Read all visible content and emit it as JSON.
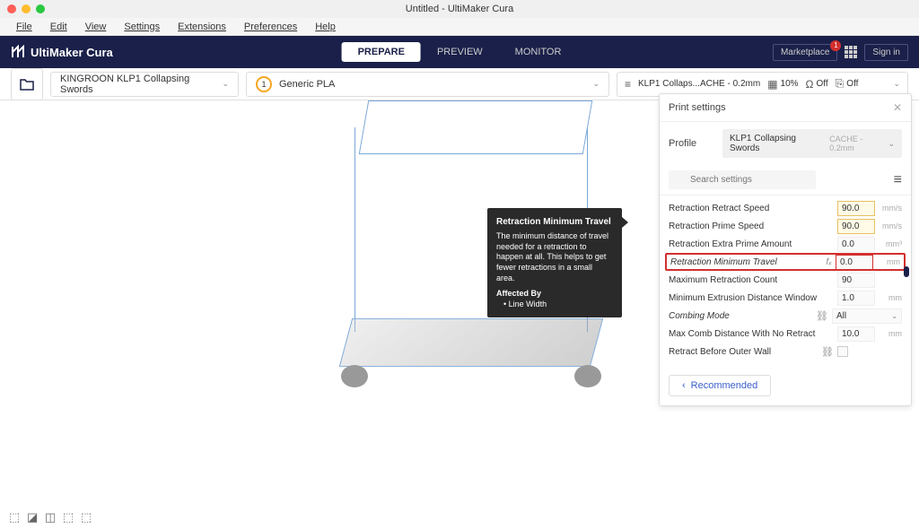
{
  "window": {
    "title": "Untitled - UltiMaker Cura"
  },
  "menubar": [
    "File",
    "Edit",
    "View",
    "Settings",
    "Extensions",
    "Preferences",
    "Help"
  ],
  "logo": "UltiMaker Cura",
  "top_tabs": {
    "prepare": "PREPARE",
    "preview": "PREVIEW",
    "monitor": "MONITOR"
  },
  "marketplace": {
    "label": "Marketplace",
    "badge": "1"
  },
  "signin": "Sign in",
  "config": {
    "printer": "KINGROON KLP1 Collapsing Swords",
    "material_number": "1",
    "material": "Generic PLA"
  },
  "print_config": {
    "profile": "KLP1 Collaps...ACHE - 0.2mm",
    "infill": "10%",
    "support": "Off",
    "adhesion": "Off"
  },
  "tooltip": {
    "title": "Retraction Minimum Travel",
    "body": "The minimum distance of travel needed for a retraction to happen at all. This helps to get fewer retractions in a small area.",
    "affected_title": "Affected By",
    "affected_items": [
      "• Line Width"
    ]
  },
  "settings_panel": {
    "title": "Print settings",
    "profile_label": "Profile",
    "profile_name": "KLP1 Collapsing Swords",
    "profile_detail": "CACHE - 0.2mm",
    "search_placeholder": "Search settings",
    "rows": [
      {
        "label": "Retraction Retract Speed",
        "value": "90.0",
        "unit": "mm/s",
        "hl": "yellow"
      },
      {
        "label": "Retraction Prime Speed",
        "value": "90.0",
        "unit": "mm/s",
        "hl": "yellow"
      },
      {
        "label": "Retraction Extra Prime Amount",
        "value": "0.0",
        "unit": "mm³"
      },
      {
        "label": "Retraction Minimum Travel",
        "value": "0.0",
        "unit": "mm",
        "fx": true,
        "active": true,
        "italic": true
      },
      {
        "label": "Maximum Retraction Count",
        "value": "90",
        "unit": ""
      },
      {
        "label": "Minimum Extrusion Distance Window",
        "value": "1.0",
        "unit": "mm"
      },
      {
        "label": "Combing Mode",
        "value": "All",
        "unit": "",
        "link": true,
        "dropdown": true,
        "italic": true
      },
      {
        "label": "Max Comb Distance With No Retract",
        "value": "10.0",
        "unit": "mm"
      },
      {
        "label": "Retract Before Outer Wall",
        "value": "",
        "unit": "",
        "link": true,
        "checkbox": true
      }
    ],
    "recommended": "Recommended"
  }
}
